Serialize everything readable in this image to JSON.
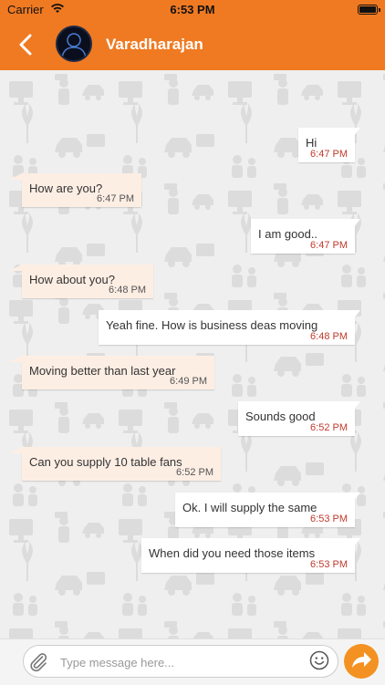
{
  "status_bar": {
    "carrier": "Carrier",
    "time": "6:53 PM"
  },
  "header": {
    "contact_name": "Varadharajan"
  },
  "messages": [
    {
      "direction": "out",
      "text": "Hi",
      "time": "6:47 PM"
    },
    {
      "direction": "in",
      "text": "How are you?",
      "time": "6:47 PM"
    },
    {
      "direction": "out",
      "text": "I am good..",
      "time": "6:47 PM"
    },
    {
      "direction": "in",
      "text": "How about you?",
      "time": "6:48 PM"
    },
    {
      "direction": "out",
      "text": "Yeah fine. How is business deas moving",
      "time": "6:48 PM"
    },
    {
      "direction": "in",
      "text": "Moving better than last year",
      "time": "6:49 PM"
    },
    {
      "direction": "out",
      "text": "Sounds good",
      "time": "6:52 PM"
    },
    {
      "direction": "in",
      "text": "Can you supply 10  table fans",
      "time": "6:52 PM"
    },
    {
      "direction": "out",
      "text": "Ok. I will supply the same",
      "time": "6:53 PM"
    },
    {
      "direction": "out",
      "text": "When did you need those items",
      "time": "6:53 PM"
    }
  ],
  "composer": {
    "placeholder": "Type message here..."
  },
  "colors": {
    "accent": "#f07a22",
    "incoming_bubble": "#fdeee4",
    "outgoing_bubble": "#ffffff",
    "send_button": "#f39222"
  },
  "icons": {
    "back": "chevron-left-icon",
    "attach": "paperclip-icon",
    "emoji": "smiley-icon",
    "send": "send-arrow-icon"
  }
}
